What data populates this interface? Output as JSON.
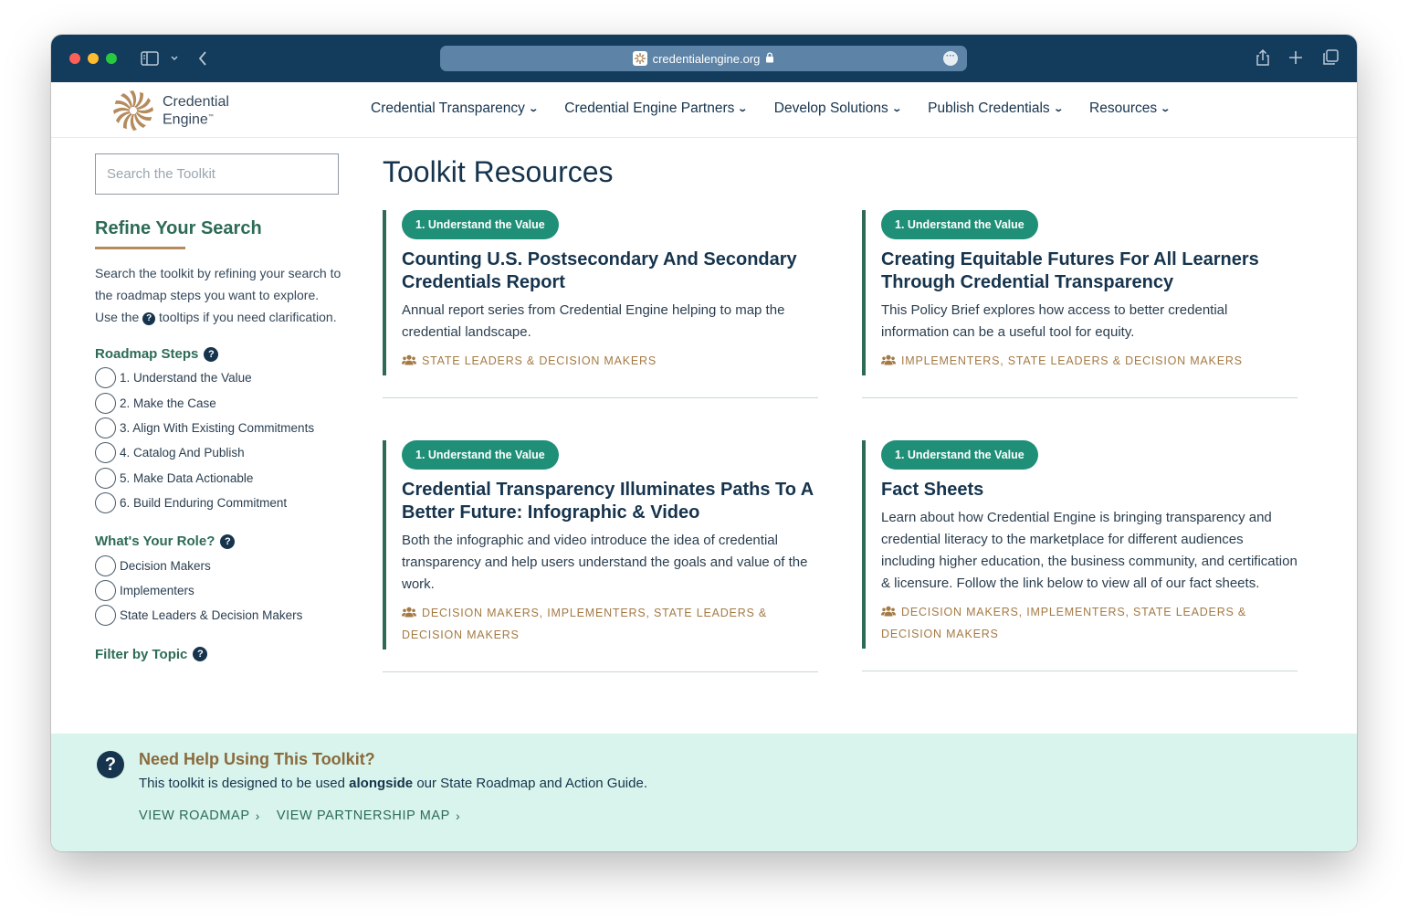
{
  "browser": {
    "url": "credentialengine.org"
  },
  "site": {
    "logo_line1": "Credential",
    "logo_line2": "Engine",
    "logo_tm": "™",
    "nav": [
      {
        "label": "Credential Transparency"
      },
      {
        "label": "Credential Engine Partners"
      },
      {
        "label": "Develop Solutions"
      },
      {
        "label": "Publish Credentials"
      },
      {
        "label": "Resources"
      }
    ]
  },
  "sidebar": {
    "search_placeholder": "Search the Toolkit",
    "refine_title": "Refine Your Search",
    "refine_desc_1": "Search the toolkit by refining your search to the roadmap steps you want to explore.",
    "refine_desc_2a": "Use the",
    "refine_desc_2b": "tooltips if you need clarification.",
    "roadmap_title": "Roadmap Steps",
    "roadmap_steps": [
      "1. Understand the Value",
      "2. Make the Case",
      "3. Align With Existing Commitments",
      "4. Catalog And Publish",
      "5. Make Data Actionable",
      "6. Build Enduring Commitment"
    ],
    "role_title": "What's Your Role?",
    "roles": [
      "Decision Makers",
      "Implementers",
      "State Leaders & Decision Makers"
    ],
    "topic_title": "Filter by Topic"
  },
  "main": {
    "title": "Toolkit Resources",
    "cards": [
      {
        "pill": "1. Understand the Value",
        "title": "Counting U.S. Postsecondary And Secondary Credentials Report",
        "desc": "Annual report series from Credential Engine helping to map the credential landscape.",
        "tags": "State Leaders & Decision Makers"
      },
      {
        "pill": "1. Understand the Value",
        "title": "Creating Equitable Futures For All Learners Through Credential Transparency",
        "desc": "This Policy Brief explores how access to better credential information can be a useful tool for equity.",
        "tags": "Implementers, State Leaders & Decision Makers"
      },
      {
        "pill": "1. Understand the Value",
        "title": "Credential Transparency Illuminates Paths To A Better Future: Infographic & Video",
        "desc": "Both the infographic and video introduce the idea of credential transparency and help users understand the goals and value of the work.",
        "tags": "Decision Makers, Implementers, State Leaders & Decision Makers"
      },
      {
        "pill": "1. Understand the Value",
        "title": "Fact Sheets",
        "desc": "Learn about how Credential Engine is bringing transparency and credential literacy to the marketplace for different audiences including higher education, the business community, and certification & licensure. Follow the link below to view all of our fact sheets.",
        "tags": "Decision Makers, Implementers, State Leaders & Decision Makers"
      }
    ]
  },
  "help": {
    "title": "Need Help Using This Toolkit?",
    "text_before": "This toolkit is designed to be used",
    "text_bold": "alongside",
    "text_after": "our State Roadmap and Action Guide.",
    "link_roadmap": "VIEW ROADMAP",
    "link_partnership": "VIEW PARTNERSHIP MAP"
  },
  "colors": {
    "chrome": "#123b5c",
    "navy": "#16344d",
    "green": "#2d6b57",
    "pill": "#1f8f77",
    "gold": "#a47a44",
    "banner": "#d8f4ec"
  }
}
